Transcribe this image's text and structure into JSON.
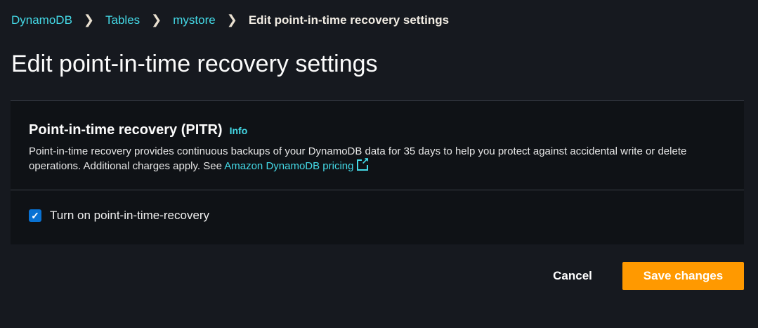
{
  "breadcrumb": {
    "items": [
      "DynamoDB",
      "Tables",
      "mystore"
    ],
    "current": "Edit point-in-time recovery settings"
  },
  "page_title": "Edit point-in-time recovery settings",
  "panel": {
    "title": "Point-in-time recovery (PITR)",
    "info": "Info",
    "description": "Point-in-time recovery provides continuous backups of your DynamoDB data for 35 days to help you protect against accidental write or delete operations. Additional charges apply. See ",
    "pricing_link": "Amazon DynamoDB pricing",
    "checkbox_label": "Turn on point-in-time-recovery",
    "checkbox_checked": true
  },
  "actions": {
    "cancel": "Cancel",
    "save": "Save changes"
  },
  "colors": {
    "link": "#44d9e6",
    "primary": "#ff9900",
    "checkbox": "#0972d3"
  }
}
